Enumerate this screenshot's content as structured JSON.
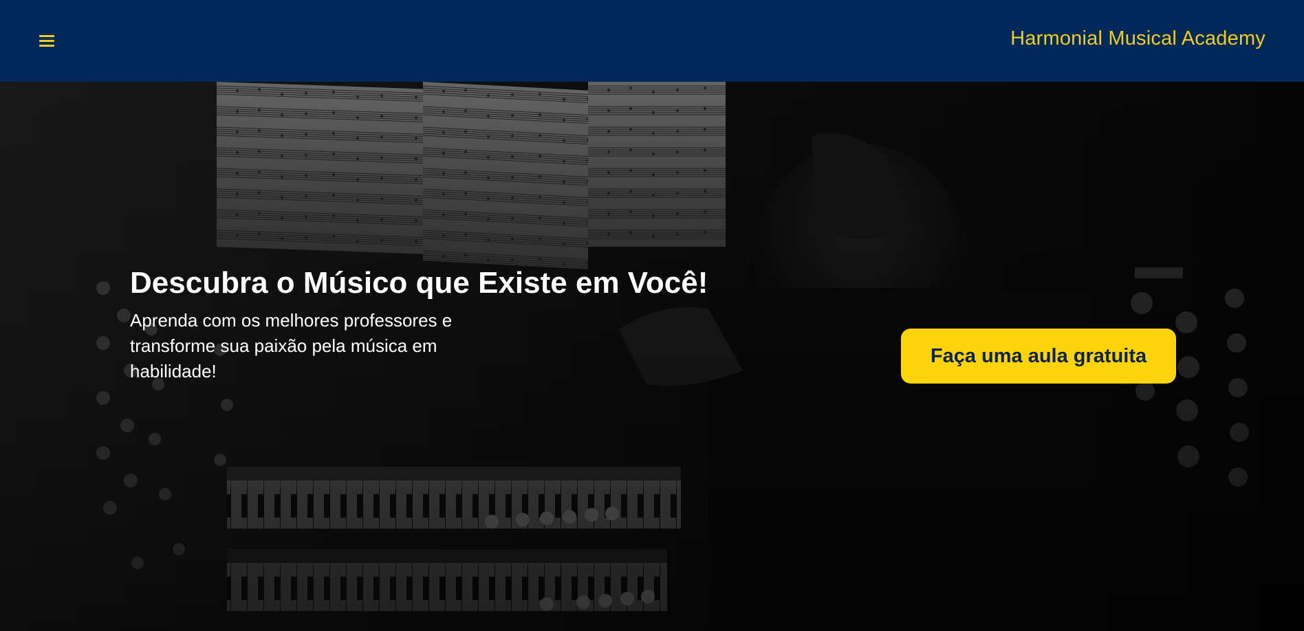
{
  "header": {
    "menu_icon": "hamburger-menu-icon",
    "brand": "Harmonial Musical Academy",
    "background_color": "#00295a",
    "accent_color": "#f2cd1e"
  },
  "hero": {
    "title": "Descubra o Músico que Existe em Você!",
    "subtitle": "Aprenda com os melhores professores e transforme sua paixão pela música em habilidade!",
    "cta_label": "Faça uma aula gratuita",
    "cta_color": "#fdd40c",
    "background_image": "organist-reading-sheet-music-grayscale"
  }
}
